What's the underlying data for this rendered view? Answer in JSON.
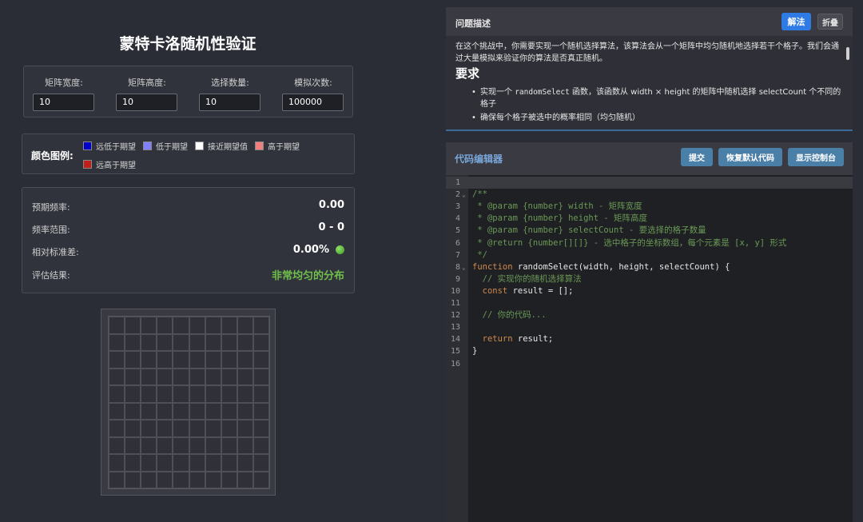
{
  "title": "蒙特卡洛随机性验证",
  "params": [
    {
      "label": "矩阵宽度:",
      "value": "10"
    },
    {
      "label": "矩阵高度:",
      "value": "10"
    },
    {
      "label": "选择数量:",
      "value": "10"
    },
    {
      "label": "模拟次数:",
      "value": "100000"
    }
  ],
  "legend": {
    "title": "颜色图例:",
    "items": [
      {
        "label": "远低于期望",
        "color": "#0000c8"
      },
      {
        "label": "低于期望",
        "color": "#8080ff"
      },
      {
        "label": "接近期望值",
        "color": "#ffffff"
      },
      {
        "label": "高于期望",
        "color": "#f08080"
      },
      {
        "label": "远高于期望",
        "color": "#c0201a"
      }
    ]
  },
  "stats": [
    {
      "label": "预期频率:",
      "value": "0.00"
    },
    {
      "label": "频率范围:",
      "value": "0 - 0"
    },
    {
      "label": "相对标准差:",
      "value": "0.00%"
    },
    {
      "label": "评估结果:",
      "value": "非常均匀的分布"
    }
  ],
  "grid": {
    "rows": 10,
    "cols": 10
  },
  "description": {
    "title": "问题描述",
    "solution_label": "解法",
    "collapse_label": "折叠",
    "intro": "在这个挑战中，你需要实现一个随机选择算法，该算法会从一个矩阵中均匀随机地选择若干个格子。我们会通过大量模拟来验证你的算法是否真正随机。",
    "req_heading": "要求",
    "req1_pre": "实现一个 ",
    "req1_code": "randomSelect",
    "req1_post": " 函数，该函数从 width × height 的矩阵中随机选择 selectCount 个不同的格子",
    "req2": "确保每个格子被选中的概率相同（均匀随机）"
  },
  "editor": {
    "title": "代码编辑器",
    "submit_label": "提交",
    "restore_label": "恢复默认代码",
    "console_label": "显示控制台",
    "lines": [
      {
        "n": "1",
        "fold": "",
        "segs": [
          {
            "c": "pl",
            "t": ""
          }
        ]
      },
      {
        "n": "2",
        "fold": "⌄",
        "segs": [
          {
            "c": "cm",
            "t": "/**"
          }
        ]
      },
      {
        "n": "3",
        "fold": "",
        "segs": [
          {
            "c": "cm",
            "t": " * @param {number} width - 矩阵宽度"
          }
        ]
      },
      {
        "n": "4",
        "fold": "",
        "segs": [
          {
            "c": "cm",
            "t": " * @param {number} height - 矩阵高度"
          }
        ]
      },
      {
        "n": "5",
        "fold": "",
        "segs": [
          {
            "c": "cm",
            "t": " * @param {number} selectCount - 要选择的格子数量"
          }
        ]
      },
      {
        "n": "6",
        "fold": "",
        "segs": [
          {
            "c": "cm",
            "t": " * @return {number[][]} - 选中格子的坐标数组，每个元素是 [x, y] 形式"
          }
        ]
      },
      {
        "n": "7",
        "fold": "",
        "segs": [
          {
            "c": "cm",
            "t": " */"
          }
        ]
      },
      {
        "n": "8",
        "fold": "⌄",
        "segs": [
          {
            "c": "kw",
            "t": "function "
          },
          {
            "c": "fn",
            "t": "randomSelect(width, height, selectCount) {"
          }
        ]
      },
      {
        "n": "9",
        "fold": "",
        "segs": [
          {
            "c": "cm",
            "t": "  // 实现你的随机选择算法"
          }
        ]
      },
      {
        "n": "10",
        "fold": "",
        "segs": [
          {
            "c": "kw",
            "t": "  const "
          },
          {
            "c": "pl",
            "t": "result = [];"
          }
        ]
      },
      {
        "n": "11",
        "fold": "",
        "segs": [
          {
            "c": "pl",
            "t": ""
          }
        ]
      },
      {
        "n": "12",
        "fold": "",
        "segs": [
          {
            "c": "cm",
            "t": "  // 你的代码..."
          }
        ]
      },
      {
        "n": "13",
        "fold": "",
        "segs": [
          {
            "c": "pl",
            "t": ""
          }
        ]
      },
      {
        "n": "14",
        "fold": "",
        "segs": [
          {
            "c": "kw",
            "t": "  return "
          },
          {
            "c": "pl",
            "t": "result;"
          }
        ]
      },
      {
        "n": "15",
        "fold": "",
        "segs": [
          {
            "c": "pl",
            "t": "}"
          }
        ]
      },
      {
        "n": "16",
        "fold": "",
        "segs": [
          {
            "c": "pl",
            "t": ""
          }
        ]
      }
    ]
  }
}
